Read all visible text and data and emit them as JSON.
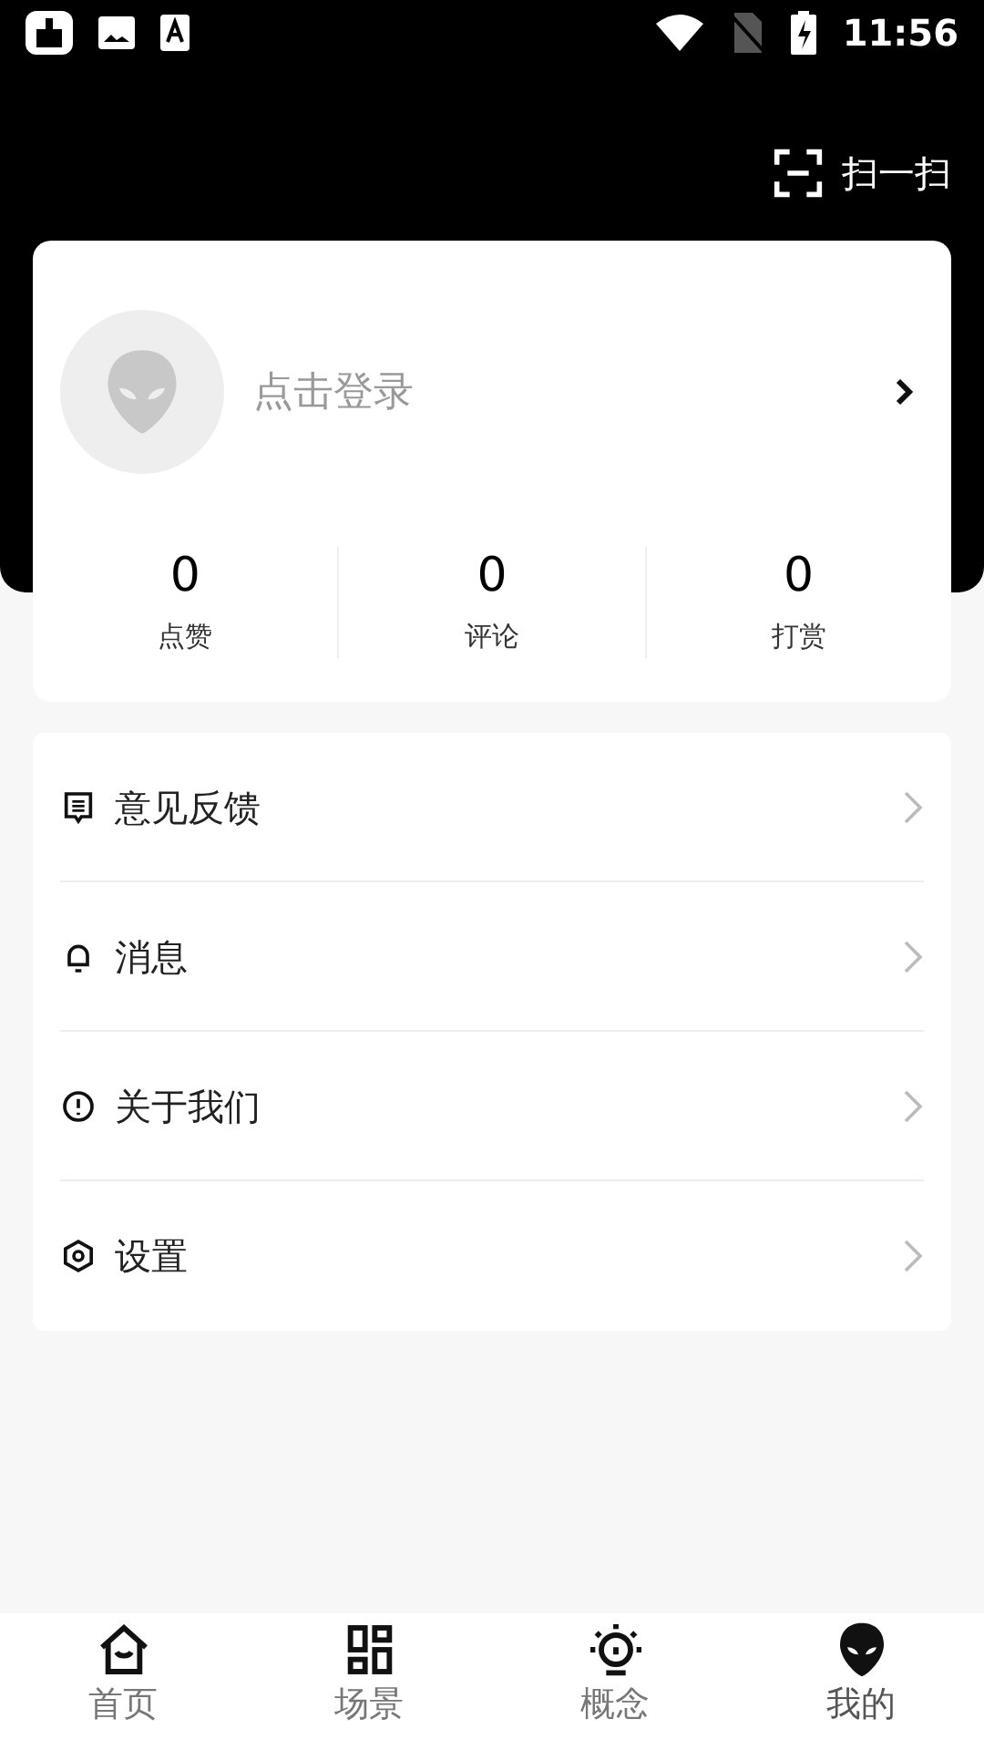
{
  "status_bar": {
    "time": "11:56"
  },
  "scan": {
    "label": "扫一扫"
  },
  "profile": {
    "login": "点击登录"
  },
  "stats": [
    {
      "value": "0",
      "label": "点赞"
    },
    {
      "value": "0",
      "label": "评论"
    },
    {
      "value": "0",
      "label": "打赏"
    }
  ],
  "menu": [
    {
      "kind": "feedback",
      "label": "意见反馈"
    },
    {
      "kind": "bell",
      "label": "消息"
    },
    {
      "kind": "about",
      "label": "关于我们"
    },
    {
      "kind": "settings",
      "label": "设置"
    }
  ],
  "tabs": [
    {
      "kind": "home",
      "label": "首页",
      "selected": false
    },
    {
      "kind": "scene",
      "label": "场景",
      "selected": false
    },
    {
      "kind": "concept",
      "label": "概念",
      "selected": false
    },
    {
      "kind": "mine",
      "label": "我的",
      "selected": true
    }
  ]
}
